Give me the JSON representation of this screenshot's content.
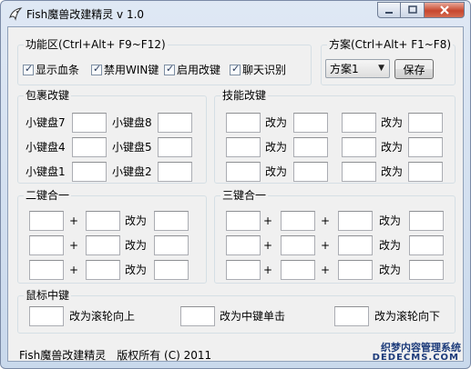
{
  "window": {
    "title": "Fish魔兽改建精灵 v 1.0"
  },
  "function_area": {
    "title": "功能区(Ctrl+Alt+ F9~F12)",
    "checkboxes": [
      {
        "label": "显示血条",
        "checked": true
      },
      {
        "label": "禁用WIN键",
        "checked": true
      },
      {
        "label": "启用改键",
        "checked": true
      },
      {
        "label": "聊天识别",
        "checked": true
      }
    ]
  },
  "scheme": {
    "title": "方案(Ctrl+Alt+ F1~F8)",
    "selected": "方案1",
    "save_label": "保存"
  },
  "inventory": {
    "title": "包裹改键",
    "slots": [
      "小键盘7",
      "小键盘8",
      "小键盘4",
      "小键盘5",
      "小键盘1",
      "小键盘2"
    ]
  },
  "skill": {
    "title": "技能改键",
    "change_to": "改为"
  },
  "combo2": {
    "title": "二键合一",
    "plus": "+",
    "change_to": "改为"
  },
  "combo3": {
    "title": "三键合一",
    "plus": "+",
    "change_to": "改为"
  },
  "mouse": {
    "title": "鼠标中键",
    "scroll_up": "改为滚轮向上",
    "middle_click": "改为中键单击",
    "scroll_down": "改为滚轮向下"
  },
  "footer": {
    "text": "Fish魔兽改建精灵　版权所有 (C) 2011"
  },
  "watermark": {
    "line1": "织梦内容管理系统",
    "line2": "DEDECMS.COM"
  }
}
